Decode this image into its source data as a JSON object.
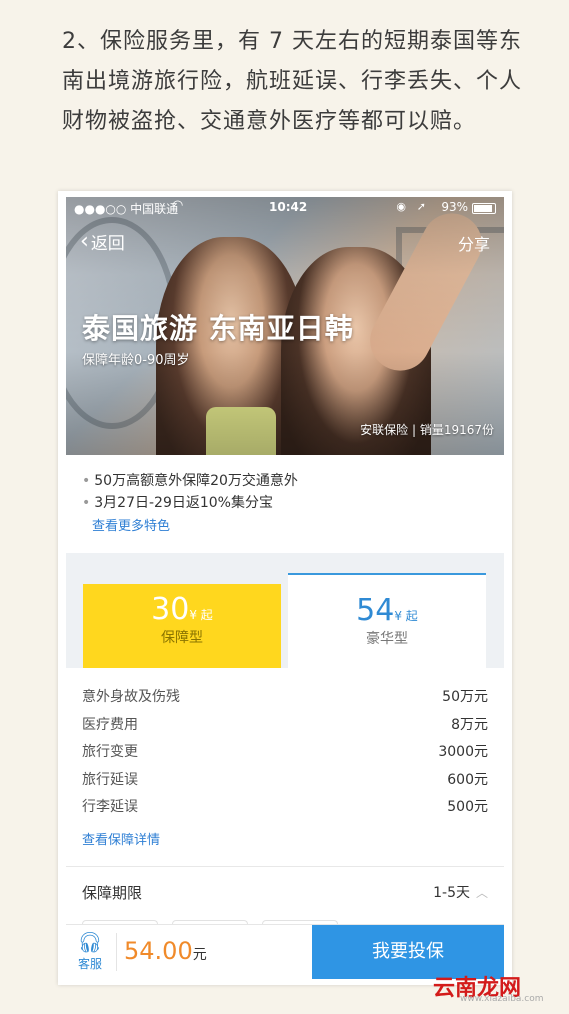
{
  "article": {
    "text": "2、保险服务里，有 7 天左右的短期泰国等东南出境游旅行险，航班延误、行李丢失、个人财物被盗抢、交通意外医疗等都可以赔。"
  },
  "status_bar": {
    "carrier": "●●●○○ 中国联通",
    "time": "10:42",
    "battery": "93%"
  },
  "nav": {
    "back_label": "返回",
    "share_label": "分享"
  },
  "hero": {
    "title": "泰国旅游 东南亚日韩",
    "subtitle": "保障年龄0-90周岁",
    "meta": "安联保险 | 销量19167份"
  },
  "features": {
    "items": [
      "50万高额意外保障20万交通意外",
      "3月27日-29日返10%集分宝"
    ],
    "more_link": "查看更多特色"
  },
  "plans": [
    {
      "price": "30",
      "unit": "¥ 起",
      "name": "保障型"
    },
    {
      "price": "54",
      "unit": "¥ 起",
      "name": "豪华型"
    }
  ],
  "coverage": {
    "rows": [
      {
        "label": "意外身故及伤残",
        "value": "50万元"
      },
      {
        "label": "医疗费用",
        "value": "8万元"
      },
      {
        "label": "旅行变更",
        "value": "3000元"
      },
      {
        "label": "旅行延误",
        "value": "600元"
      },
      {
        "label": "行李延误",
        "value": "500元"
      }
    ],
    "detail_link": "查看保障详情"
  },
  "period": {
    "label": "保障期限",
    "value": "1-5天"
  },
  "bottom": {
    "cs_label": "客服",
    "price": "54.00",
    "price_unit": "元",
    "buy_label": "我要投保"
  },
  "watermark": {
    "logo": "云南龙网",
    "url": "www.xiazaiba.com"
  },
  "colors": {
    "accent_blue": "#2f95e4",
    "plan_yellow": "#ffd71e",
    "price_orange": "#f08a2a"
  }
}
